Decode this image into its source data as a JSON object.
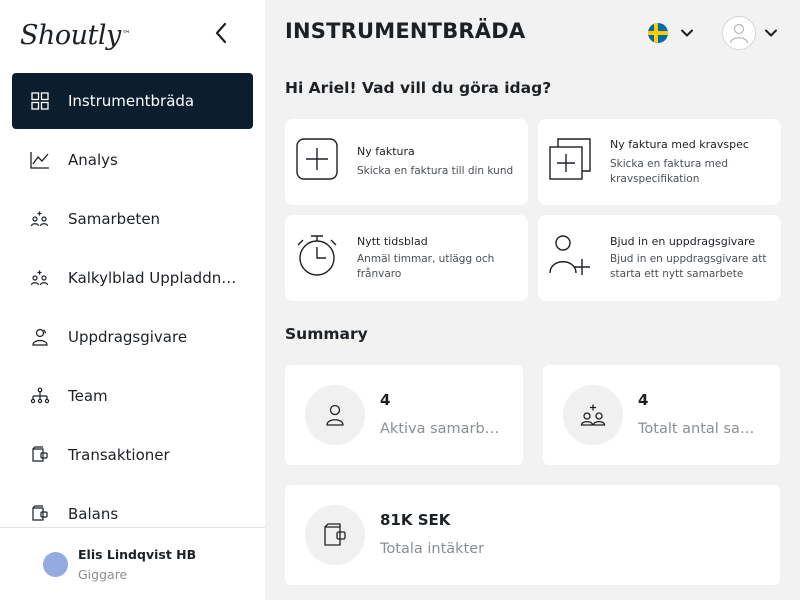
{
  "brand": {
    "name": "Shoutly",
    "mark": "™"
  },
  "sidebar": {
    "items": [
      {
        "label": "Instrumentbräda",
        "icon": "dashboard-grid-icon",
        "active": true
      },
      {
        "label": "Analys",
        "icon": "line-chart-icon"
      },
      {
        "label": "Samarbeten",
        "icon": "people-plus-icon"
      },
      {
        "label": "Kalkylblad Uppladdningar",
        "icon": "people-plus-icon"
      },
      {
        "label": "Uppdragsgivare",
        "icon": "client-icon"
      },
      {
        "label": "Team",
        "icon": "team-tree-icon"
      },
      {
        "label": "Transaktioner",
        "icon": "wallet-icon"
      },
      {
        "label": "Balans",
        "icon": "wallet-icon"
      }
    ],
    "user": {
      "name": "Elis Lindqvist HB",
      "role": "Giggare"
    }
  },
  "header": {
    "title": "INSTRUMENTBRÄDA",
    "language_flag": "sweden-flag-icon"
  },
  "main": {
    "greeting": "Hi Ariel! Vad vill du göra idag?",
    "actions": [
      {
        "title": "Ny faktura",
        "desc": "Skicka en faktura till din kund",
        "icon": "add-square-icon"
      },
      {
        "title": "Ny faktura med kravspec",
        "desc": "Skicka en faktura med kravspecifikation",
        "icon": "add-document-icon"
      },
      {
        "title": "Nytt tidsblad",
        "desc": "Anmäl timmar, utlägg och frånvaro",
        "icon": "stopwatch-icon"
      },
      {
        "title": "Bjud in en uppdragsgivare",
        "desc": "Bjud in en uppdragsgivare att starta ett nytt samarbete",
        "icon": "add-user-icon"
      }
    ],
    "summary_title": "Summary",
    "summary": [
      {
        "value": "4",
        "label": "Aktiva samarbeten",
        "icon": "person-icon"
      },
      {
        "value": "4",
        "label": "Totalt antal samarbeten",
        "icon": "people-plus-icon"
      },
      {
        "value": "81K SEK",
        "label": "Totala intäkter",
        "icon": "wallet-icon"
      }
    ]
  },
  "colors": {
    "active_nav": "#0c1e2e",
    "background": "#f2f2f2",
    "avatar": "#93abe0"
  }
}
